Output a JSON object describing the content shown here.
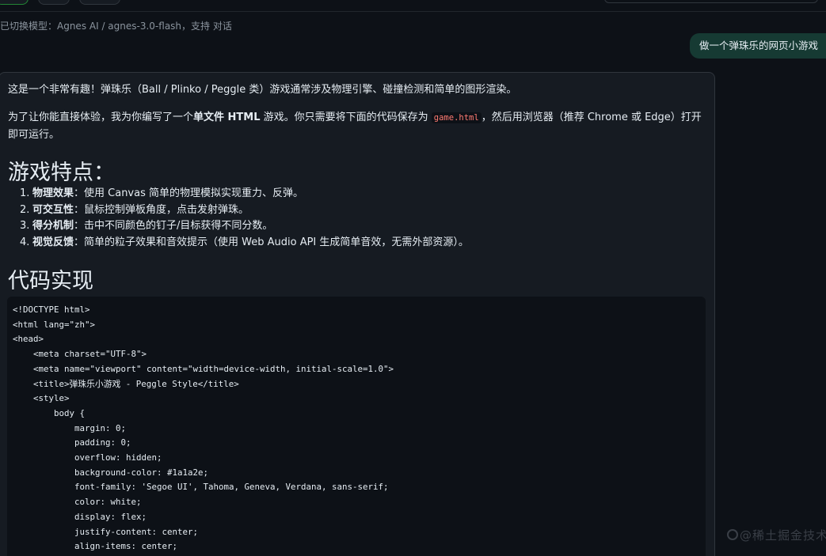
{
  "system_note": "已切换模型：Agnes AI / agnes-3.0-flash，支持 对话",
  "user_message": "做一个弹珠乐的网页小游戏",
  "assistant": {
    "intro": "这是一个非常有趣！弹珠乐（Ball / Plinko / Peggle 类）游戏通常涉及物理引擎、碰撞检测和简单的图形渲染。",
    "p2_before": "为了让你能直接体验，我为你编写了一个",
    "p2_bold": "单文件 HTML",
    "p2_mid": " 游戏。你只需要将下面的代码保存为 ",
    "p2_code": "game.html",
    "p2_after": "，然后用浏览器（推荐 Chrome 或 Edge）打开即可运行。",
    "features_heading": "游戏特点：",
    "features": [
      {
        "num": "1.",
        "title": "物理效果",
        "desc": "：使用 Canvas 简单的物理模拟实现重力、反弹。"
      },
      {
        "num": "2.",
        "title": "可交互性",
        "desc": "：鼠标控制弹板角度，点击发射弹珠。"
      },
      {
        "num": "3.",
        "title": "得分机制",
        "desc": "：击中不同颜色的钉子/目标获得不同分数。"
      },
      {
        "num": "4.",
        "title": "视觉反馈",
        "desc": "：简单的粒子效果和音效提示（使用 Web Audio API 生成简单音效，无需外部资源）。"
      }
    ],
    "code_heading": "代码实现",
    "code_lines": [
      "<!DOCTYPE html>",
      "<html lang=\"zh\">",
      "<head>",
      "    <meta charset=\"UTF-8\">",
      "    <meta name=\"viewport\" content=\"width=device-width, initial-scale=1.0\">",
      "    <title>弹珠乐小游戏 - Peggle Style</title>",
      "    <style>",
      "        body {",
      "            margin: 0;",
      "            padding: 0;",
      "            overflow: hidden;",
      "            background-color: #1a1a2e;",
      "            font-family: 'Segoe UI', Tahoma, Geneva, Verdana, sans-serif;",
      "            color: white;",
      "            display: flex;",
      "            justify-content: center;",
      "            align-items: center;",
      ""
    ]
  },
  "watermark": "@稀土掘金技术社区",
  "colors": {
    "background": "#0d1117",
    "card": "#161b22",
    "user_bubble": "#163a33",
    "inline_code": "#ff7b72"
  }
}
